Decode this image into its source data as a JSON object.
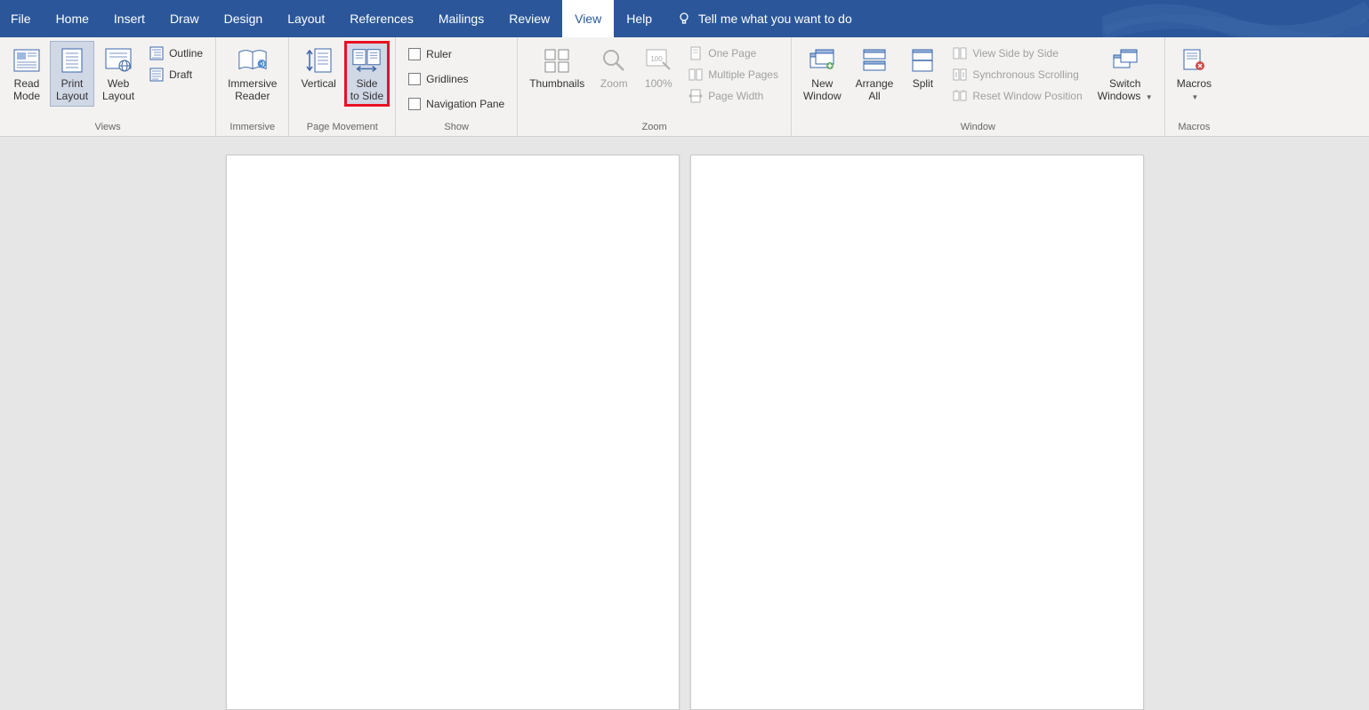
{
  "menu": {
    "tabs": [
      "File",
      "Home",
      "Insert",
      "Draw",
      "Design",
      "Layout",
      "References",
      "Mailings",
      "Review",
      "View",
      "Help"
    ],
    "active": "View",
    "tell_me": "Tell me what you want to do"
  },
  "ribbon": {
    "views": {
      "label": "Views",
      "read_mode": "Read\nMode",
      "print_layout": "Print\nLayout",
      "web_layout": "Web\nLayout",
      "outline": "Outline",
      "draft": "Draft"
    },
    "immersive": {
      "label": "Immersive",
      "immersive_reader": "Immersive\nReader"
    },
    "page_movement": {
      "label": "Page Movement",
      "vertical": "Vertical",
      "side_to_side": "Side\nto Side"
    },
    "show": {
      "label": "Show",
      "ruler": "Ruler",
      "gridlines": "Gridlines",
      "navigation_pane": "Navigation Pane"
    },
    "zoom": {
      "label": "Zoom",
      "thumbnails": "Thumbnails",
      "zoom": "Zoom",
      "hundred": "100%",
      "one_page": "One Page",
      "multiple_pages": "Multiple Pages",
      "page_width": "Page Width"
    },
    "window": {
      "label": "Window",
      "new_window": "New\nWindow",
      "arrange_all": "Arrange\nAll",
      "split": "Split",
      "side_by_side": "View Side by Side",
      "sync_scroll": "Synchronous Scrolling",
      "reset_pos": "Reset Window Position",
      "switch_windows": "Switch\nWindows"
    },
    "macros": {
      "label": "Macros",
      "macros": "Macros"
    }
  }
}
